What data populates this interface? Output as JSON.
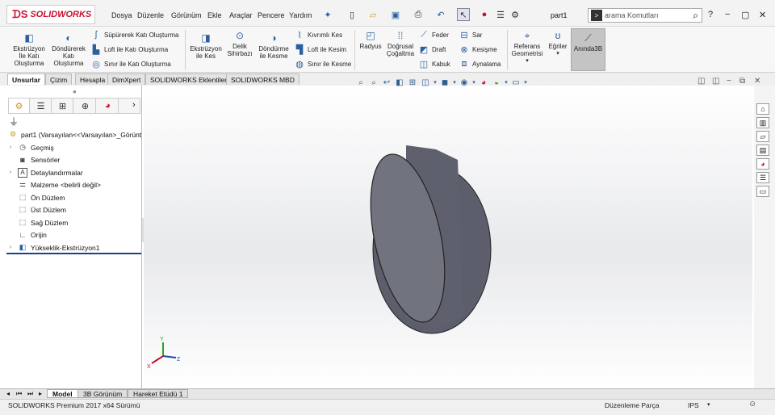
{
  "app": {
    "logo_text": "SOLIDWORKS",
    "doc_title": "part1"
  },
  "menu": [
    "Dosya",
    "Düzenle",
    "Görünüm",
    "Ekle",
    "Araçlar",
    "Pencere",
    "Yardım"
  ],
  "search": {
    "placeholder": "arama Komutları"
  },
  "titlebar_icons": [
    "pin-icon",
    "new-document-icon",
    "open-icon",
    "save-icon",
    "print-icon",
    "undo-icon",
    "select-icon",
    "rebuild-icon",
    "file-properties-icon",
    "options-icon"
  ],
  "ribbon": {
    "extrude_boss": "Ekstrüzyon İle Katı Oluşturma",
    "revolve_boss": "Döndürerek Katı Oluşturma",
    "swept_boss": "Süpürerek Katı Oluşturma",
    "loft_boss": "Loft ile Katı Oluşturma",
    "boundary_boss": "Sınır ile Katı Oluşturma",
    "extrude_cut": "Ekstrüzyon ile Kes",
    "hole_wizard": "Delik Sihirbazı",
    "revolve_cut": "Döndürme ile Kesme",
    "swept_cut": "Kıvrımlı Kes",
    "loft_cut": "Loft ile Kesim",
    "boundary_cut": "Sınır ile Kesme",
    "fillet": "Radyus",
    "linear_pattern": "Doğrusal Çoğaltma",
    "rib": "Feder",
    "draft": "Draft",
    "shell": "Kabuk",
    "wrap": "Sar",
    "intersect": "Kesişme",
    "mirror": "Aynalama",
    "ref_geometry": "Referans Geometrisi",
    "curves": "Eğriler",
    "instant3d": "Anında3B"
  },
  "tabs": [
    "Unsurlar",
    "Çizim",
    "Hesapla",
    "DimXpert",
    "SOLIDWORKS Eklentileri",
    "SOLIDWORKS MBD"
  ],
  "tree": {
    "root": "part1  (Varsayılan<<Varsayılan>_Görünt",
    "items": [
      "Geçmiş",
      "Sensörler",
      "Detaylandırmalar",
      "Malzeme <belirli değil>",
      "Ön Düzlem",
      "Üst Düzlem",
      "Sağ Düzlem",
      "Orijin",
      "Yükseklik-Ekstrüzyon1"
    ]
  },
  "triad": {
    "x": "X",
    "y": "Y",
    "z": "Z"
  },
  "bottom_tabs": [
    "Model",
    "3B Görünüm",
    "Hareket Etüdü 1"
  ],
  "status": {
    "version": "SOLIDWORKS Premium 2017 x64 Sürümü",
    "mode": "Düzenleme Parça",
    "units": "IPS"
  },
  "colors": {
    "accent": "#c8102e",
    "tree_accent": "#1f3f8a",
    "cylinder_face": "#70727f",
    "cylinder_side": "#5d5f6d"
  }
}
